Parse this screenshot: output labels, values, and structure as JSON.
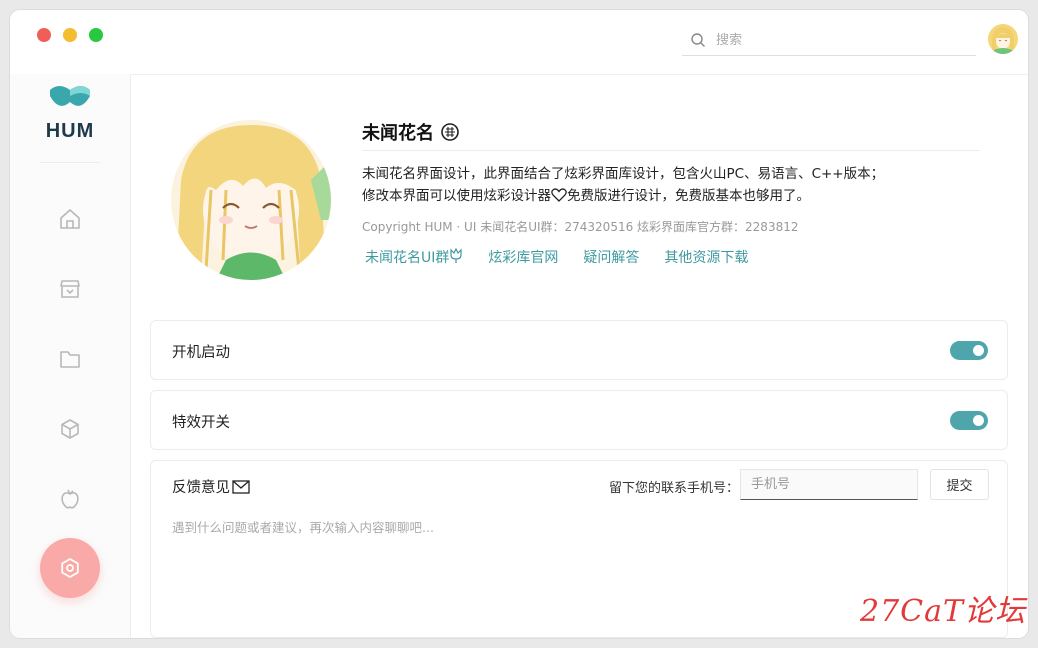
{
  "titlebar": {
    "search_placeholder": "搜索"
  },
  "sidebar": {
    "brand": "HUM",
    "items": [
      {
        "name": "home"
      },
      {
        "name": "store"
      },
      {
        "name": "folder"
      },
      {
        "name": "box"
      },
      {
        "name": "apple"
      },
      {
        "name": "settings",
        "active": true
      }
    ]
  },
  "profile": {
    "name": "未闻花名",
    "desc_line1": "未闻花名界面设计，此界面结合了炫彩界面库设计，包含火山PC、易语言、C++版本；",
    "desc_line2a": "修改本界面可以使用炫彩设计器",
    "desc_line2b": "免费版进行设计，免费版基本也够用了。",
    "copyright": "Copyright HUM · UI  未闻花名UI群：274320516  炫彩界面库官方群：2283812",
    "links": [
      "未闻花名UI群",
      "炫彩库官网",
      "疑问解答",
      "其他资源下载"
    ]
  },
  "settings": {
    "autostart_label": "开机启动",
    "autostart_on": true,
    "effects_label": "特效开关",
    "effects_on": true
  },
  "feedback": {
    "title": "反馈意见",
    "phone_label": "留下您的联系手机号：",
    "phone_placeholder": "手机号",
    "submit_label": "提交",
    "text_placeholder": "遇到什么问题或者建议，再次输入内容聊聊吧..."
  },
  "watermark": "27CaT论坛",
  "colors": {
    "accent": "#4ea6ac",
    "link": "#3f9aa0",
    "active_nav": "#f9a9a7"
  }
}
